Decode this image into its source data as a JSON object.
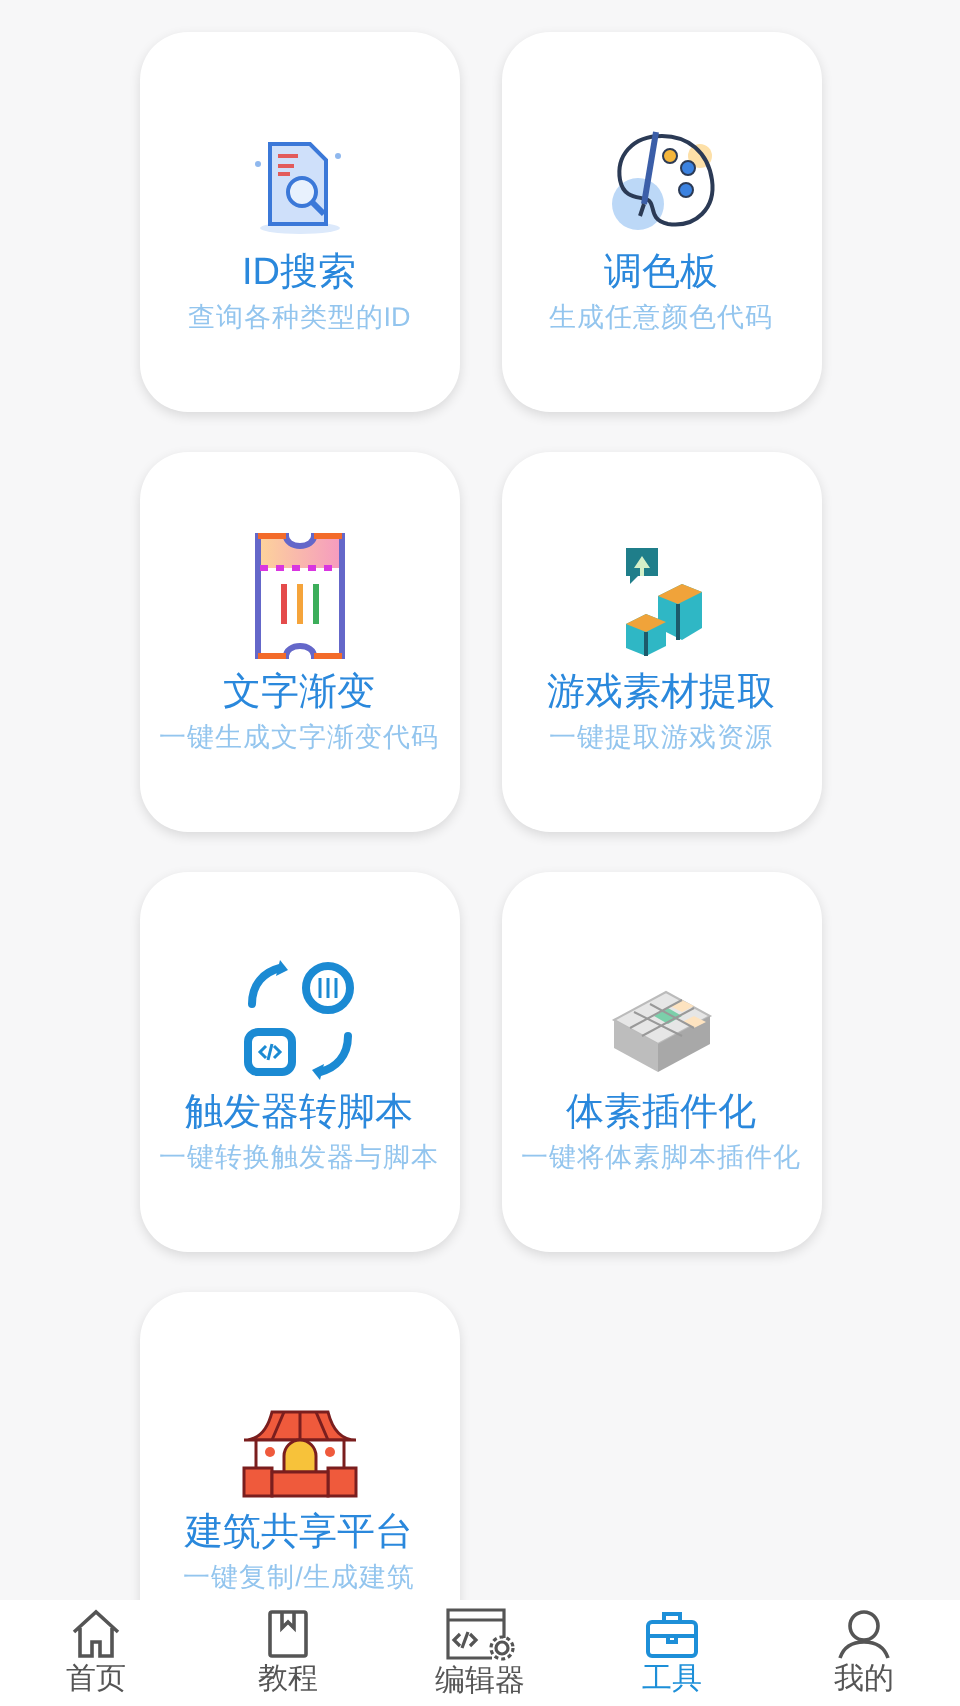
{
  "tools": [
    {
      "kind": "doc-search",
      "title": "ID搜索",
      "subtitle": "查询各种类型的ID"
    },
    {
      "kind": "palette",
      "title": "调色板",
      "subtitle": "生成任意颜色代码"
    },
    {
      "kind": "ticket",
      "title": "文字渐变",
      "subtitle": "一键生成文字渐变代码"
    },
    {
      "kind": "boxes",
      "title": "游戏素材提取",
      "subtitle": "一键提取游戏资源"
    },
    {
      "kind": "convert",
      "title": "触发器转脚本",
      "subtitle": "一键转换触发器与脚本"
    },
    {
      "kind": "voxel",
      "title": "体素插件化",
      "subtitle": "一键将体素脚本插件化"
    },
    {
      "kind": "temple",
      "title": "建筑共享平台",
      "subtitle": "一键复制/生成建筑"
    }
  ],
  "nav": [
    {
      "kind": "home",
      "label": "首页",
      "selected": false
    },
    {
      "kind": "book",
      "label": "教程",
      "selected": false
    },
    {
      "kind": "editor",
      "label": "编辑器",
      "selected": false
    },
    {
      "kind": "toolbox",
      "label": "工具",
      "selected": true
    },
    {
      "kind": "user",
      "label": "我的",
      "selected": false
    }
  ]
}
